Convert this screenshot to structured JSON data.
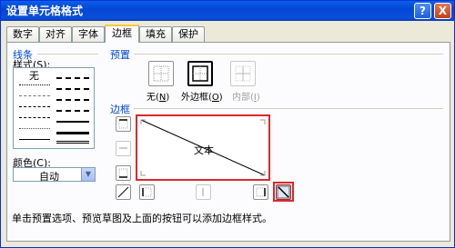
{
  "window": {
    "title": "设置单元格格式",
    "help": "?",
    "close": "X"
  },
  "tabs": [
    {
      "label": "数字"
    },
    {
      "label": "对齐"
    },
    {
      "label": "字体"
    },
    {
      "label": "边框"
    },
    {
      "label": "填充"
    },
    {
      "label": "保护"
    }
  ],
  "line": {
    "group": "线条",
    "style_label": "样式(S):",
    "none_label": "无",
    "color_label": "颜色(C):",
    "color_value": "自动"
  },
  "presets": {
    "group": "预置",
    "none": {
      "text": "无",
      "key": "N"
    },
    "outline": {
      "text": "外边框",
      "key": "O"
    },
    "inside": {
      "text": "内部",
      "key": "I"
    }
  },
  "border": {
    "group": "边框",
    "preview_text": "文本",
    "accent": "#d9292d"
  },
  "hint": "单击预置选项、预览草图及上面的按钮可以添加边框样式。"
}
